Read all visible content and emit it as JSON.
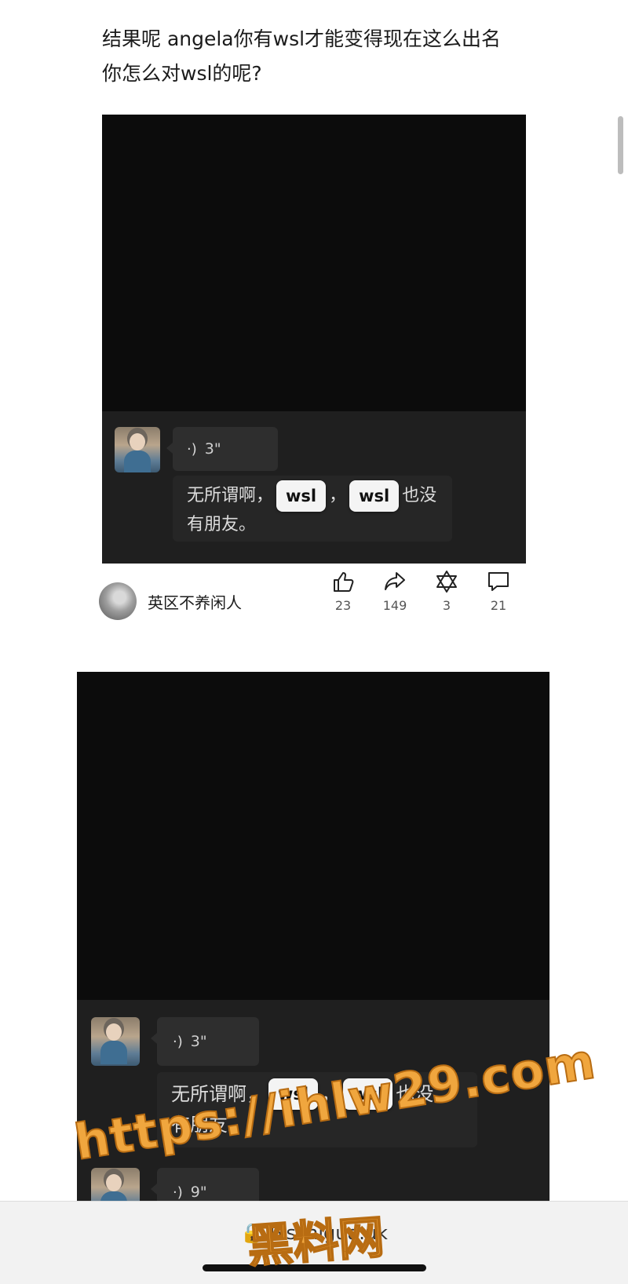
{
  "post": {
    "text": "结果呢 angela你有wsl才能变得现在这么出名 你怎么对wsl的呢?"
  },
  "screenshots": [
    {
      "voice_duration": "3\"",
      "message_before": "无所谓啊，",
      "tag1": "wsl",
      "message_middle": "，",
      "tag2": "wsl",
      "message_after": "也没",
      "message_line2": "有朋友。"
    },
    {
      "voice_duration": "3\"",
      "message_before": "无所谓啊，",
      "tag1": "wsl",
      "message_middle": "，",
      "tag2": "wsl",
      "message_after": "也没",
      "message_line2": "有朋友。",
      "next_voice_duration": "9\""
    }
  ],
  "author": {
    "name": "英区不养闲人"
  },
  "actions": {
    "like_count": "23",
    "share_count": "149",
    "collect_count": "3",
    "comment_count": "21"
  },
  "browser": {
    "url": "lxschigua.uk"
  },
  "watermark": {
    "url": "https://ihlw29.com",
    "name": "黑料网"
  },
  "colors": {
    "watermark": "#f0a63e",
    "dark_panel": "#1f1f1f"
  }
}
